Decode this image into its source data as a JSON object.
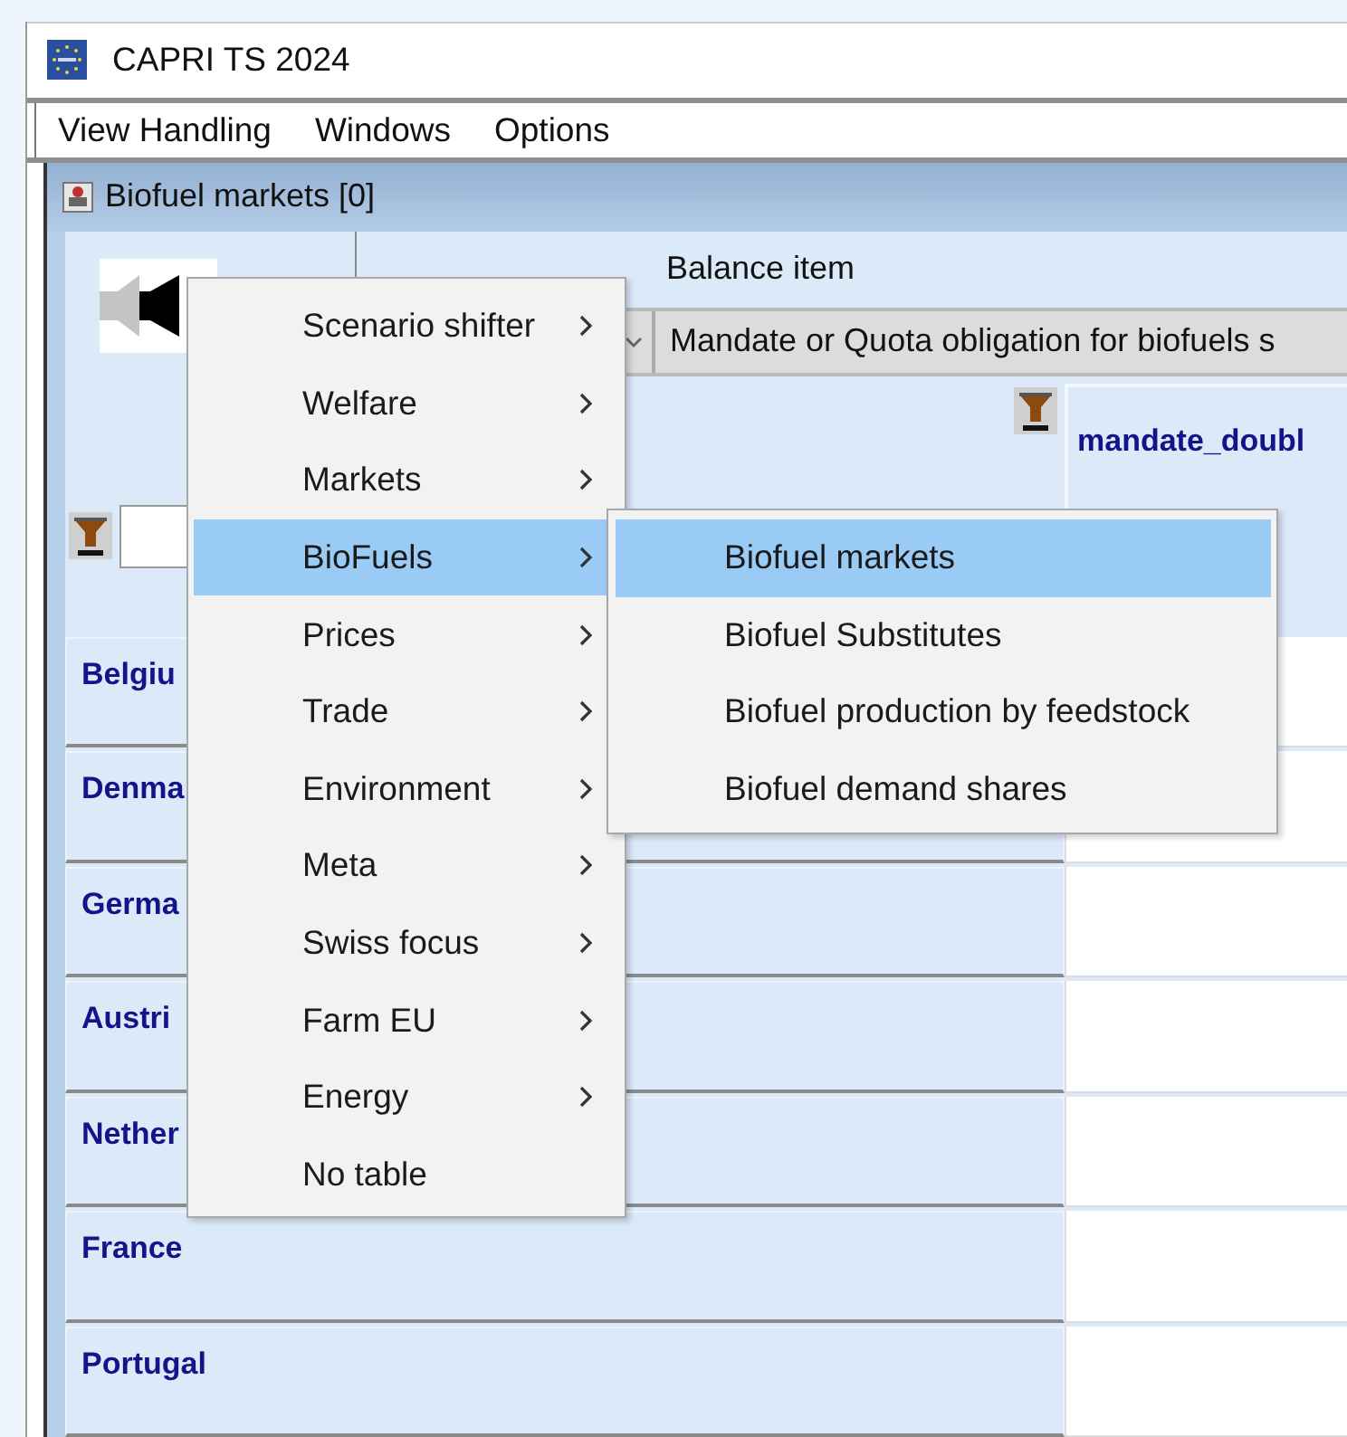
{
  "window": {
    "title": "CAPRI TS 2024"
  },
  "menu_bar": [
    "View Handling",
    "Windows",
    "Options"
  ],
  "frame": {
    "title": "Biofuel markets [0]"
  },
  "column_dimension": {
    "label": "Balance item",
    "selection": "Mandate or Quota obligation for biofuels s"
  },
  "column_headers": [
    "mandate_doubl"
  ],
  "rows": [
    "Belgiu",
    "Denma",
    "Germa",
    "Austri",
    "Nether",
    "France",
    "Portugal"
  ],
  "popup_menu": {
    "items": [
      {
        "label": "Scenario shifter",
        "submenu": true,
        "selected": false
      },
      {
        "label": "Welfare",
        "submenu": true,
        "selected": false
      },
      {
        "label": "Markets",
        "submenu": true,
        "selected": false
      },
      {
        "label": "BioFuels",
        "submenu": true,
        "selected": true
      },
      {
        "label": "Prices",
        "submenu": true,
        "selected": false
      },
      {
        "label": "Trade",
        "submenu": true,
        "selected": false
      },
      {
        "label": "Environment",
        "submenu": true,
        "selected": false
      },
      {
        "label": "Meta",
        "submenu": true,
        "selected": false
      },
      {
        "label": "Swiss focus",
        "submenu": true,
        "selected": false
      },
      {
        "label": "Farm EU",
        "submenu": true,
        "selected": false
      },
      {
        "label": "Energy",
        "submenu": true,
        "selected": false
      },
      {
        "label": "No table",
        "submenu": false,
        "selected": false
      }
    ]
  },
  "submenu": {
    "items": [
      {
        "label": "Biofuel markets",
        "selected": true
      },
      {
        "label": "Biofuel Substitutes",
        "selected": false
      },
      {
        "label": "Biofuel production by feedstock",
        "selected": false
      },
      {
        "label": "Biofuel demand shares",
        "selected": false
      }
    ]
  }
}
